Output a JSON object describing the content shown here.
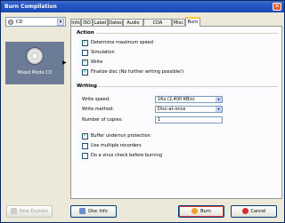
{
  "window": {
    "title": "Burn Compilation",
    "close_glyph": "✕"
  },
  "leftpanel": {
    "drive_label": "CD",
    "arrow_glyph": "▾",
    "item_label": "Mixed Mode CD",
    "sel_glyph": "▶"
  },
  "tabs": [
    {
      "label": "Info"
    },
    {
      "label": "ISO"
    },
    {
      "label": "Label"
    },
    {
      "label": "Dates"
    },
    {
      "label": "Audio CD"
    },
    {
      "label": "CDA Options"
    },
    {
      "label": "Misc"
    },
    {
      "label": "Burn"
    }
  ],
  "action": {
    "heading": "Action",
    "items": [
      {
        "label": "Determine maximum speed",
        "checked": true
      },
      {
        "label": "Simulation",
        "checked": false
      },
      {
        "label": "Write",
        "checked": true
      },
      {
        "label": "Finalize disc (No further writing possible!)",
        "checked": true
      }
    ]
  },
  "writing": {
    "heading": "Writing",
    "speed_label": "Write speed:",
    "speed_value": "16x (2,400 KB/s)",
    "method_label": "Write method:",
    "method_value": "Disc-at-once",
    "copies_label": "Number of copies:",
    "copies_value": "1",
    "dd_glyph": "▾",
    "options": [
      {
        "label": "Buffer underrun protection",
        "checked": true
      },
      {
        "label": "Use multiple recorders",
        "checked": false
      },
      {
        "label": "Do a virus check before burning",
        "checked": false
      }
    ]
  },
  "buttons": {
    "new_express": "New Express",
    "disc_info": "Disc Info",
    "burn": "Burn",
    "cancel": "Cancel"
  },
  "colors": {
    "title_bar": "#2455c4",
    "selection": "#6d7c96",
    "check": "#21a121"
  }
}
